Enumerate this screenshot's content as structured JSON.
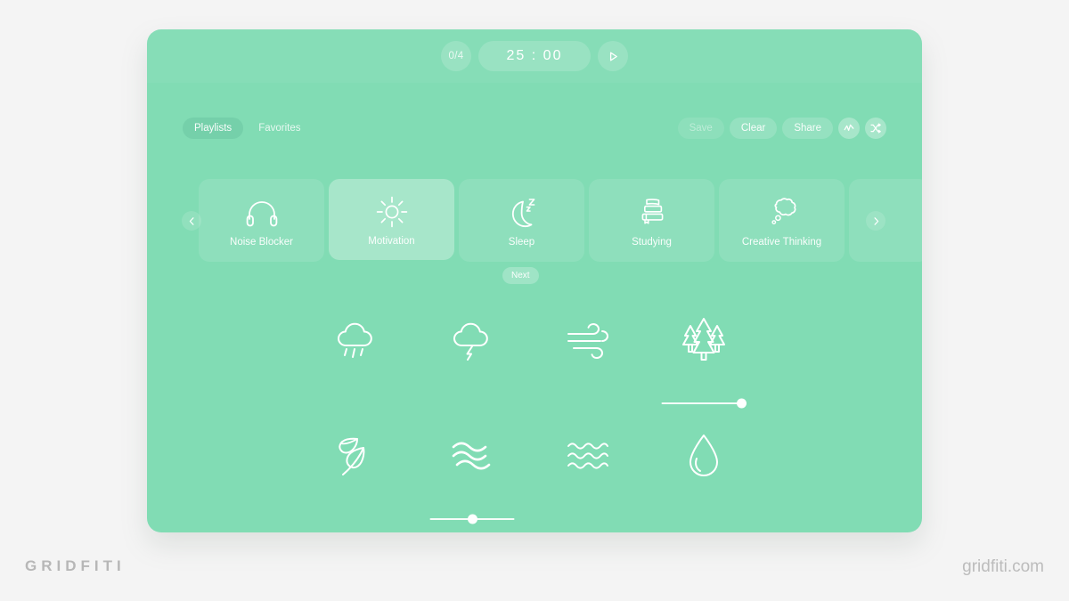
{
  "app": {
    "timer": {
      "session_counter": "0/4",
      "time_display": "25 : 00",
      "play_icon": "play-icon"
    },
    "tabs": [
      {
        "label": "Playlists",
        "active": true
      },
      {
        "label": "Favorites",
        "active": false
      }
    ],
    "actions": [
      {
        "label": "Save",
        "disabled": true
      },
      {
        "label": "Clear",
        "disabled": false
      },
      {
        "label": "Share",
        "disabled": false
      }
    ],
    "icon_actions": [
      {
        "name": "waveform-icon"
      },
      {
        "name": "shuffle-icon"
      }
    ],
    "carousel": {
      "prev_icon": "chevron-left-icon",
      "next_icon": "chevron-right-icon",
      "cards": [
        {
          "label": "Noise Blocker",
          "icon": "headphones-icon",
          "selected": false
        },
        {
          "label": "Motivation",
          "icon": "sun-icon",
          "selected": true
        },
        {
          "label": "Sleep",
          "icon": "moon-sleep-icon",
          "selected": false
        },
        {
          "label": "Studying",
          "icon": "books-icon",
          "selected": false
        },
        {
          "label": "Creative Thinking",
          "icon": "thought-bubble-icon",
          "selected": false
        }
      ],
      "next_button_label": "Next"
    },
    "sounds": [
      {
        "name": "rain-cloud-icon",
        "label": "Rain",
        "active": false,
        "volume": null
      },
      {
        "name": "thunder-cloud-icon",
        "label": "Thunder",
        "active": false,
        "volume": null
      },
      {
        "name": "wind-icon",
        "label": "Wind",
        "active": false,
        "volume": null
      },
      {
        "name": "forest-trees-icon",
        "label": "Forest",
        "active": true,
        "volume": 95
      },
      {
        "name": "leaves-icon",
        "label": "Leaves",
        "active": false,
        "volume": null
      },
      {
        "name": "river-waves-icon",
        "label": "River",
        "active": true,
        "volume": 50
      },
      {
        "name": "ocean-waves-icon",
        "label": "Ocean",
        "active": false,
        "volume": null
      },
      {
        "name": "water-drop-icon",
        "label": "Water Drop",
        "active": false,
        "volume": null
      }
    ]
  },
  "branding": {
    "logo_text": "GRIDFITI",
    "website": "gridfiti.com"
  },
  "colors": {
    "app_background": "#81dcb4",
    "page_background": "#f4f4f4",
    "accent_white": "#ffffff",
    "brand_gray": "#b7b7b7"
  }
}
